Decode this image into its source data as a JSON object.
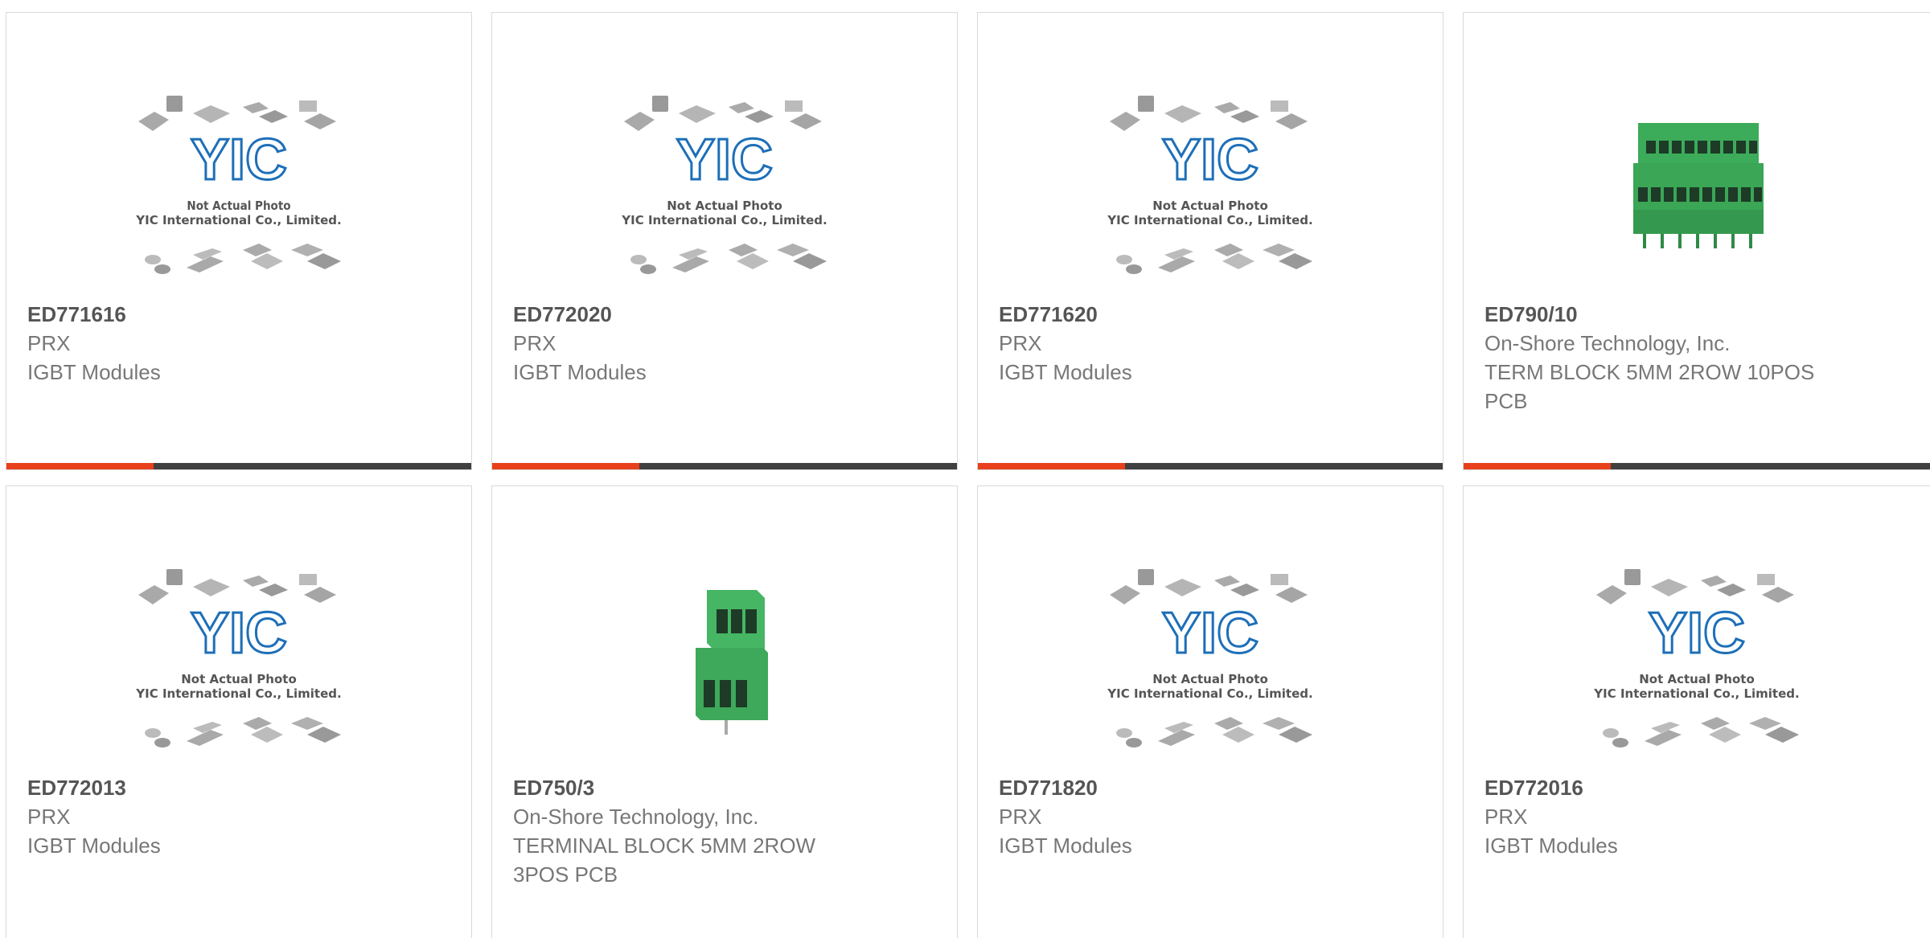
{
  "theme": {
    "accent": "#e8401c",
    "bar_dark": "#404040",
    "logo_blue": "#1d6fb8",
    "terminal_green": "#3cab5a"
  },
  "placeholder": {
    "caption_line1": "Not Actual Photo",
    "caption_line2": "YIC International Co., Limited.",
    "logo_text": "YIC"
  },
  "cards": [
    {
      "part_no": "ED771616",
      "manufacturer": "PRX",
      "description": "IGBT Modules",
      "image": "placeholder"
    },
    {
      "part_no": "ED772020",
      "manufacturer": "PRX",
      "description": "IGBT Modules",
      "image": "placeholder"
    },
    {
      "part_no": "ED771620",
      "manufacturer": "PRX",
      "description": "IGBT Modules",
      "image": "placeholder"
    },
    {
      "part_no": "ED790/10",
      "manufacturer": "On-Shore Technology, Inc.",
      "description": "TERM BLOCK 5MM 2ROW 10POS PCB",
      "image": "terminal-block-10pos-photo"
    },
    {
      "part_no": "ED772013",
      "manufacturer": "PRX",
      "description": "IGBT Modules",
      "image": "placeholder"
    },
    {
      "part_no": "ED750/3",
      "manufacturer": "On-Shore Technology, Inc.",
      "description": "TERMINAL BLOCK 5MM 2ROW 3POS PCB",
      "image": "terminal-block-3pos-photo"
    },
    {
      "part_no": "ED771820",
      "manufacturer": "PRX",
      "description": "IGBT Modules",
      "image": "placeholder"
    },
    {
      "part_no": "ED772016",
      "manufacturer": "PRX",
      "description": "IGBT Modules",
      "image": "placeholder"
    }
  ]
}
